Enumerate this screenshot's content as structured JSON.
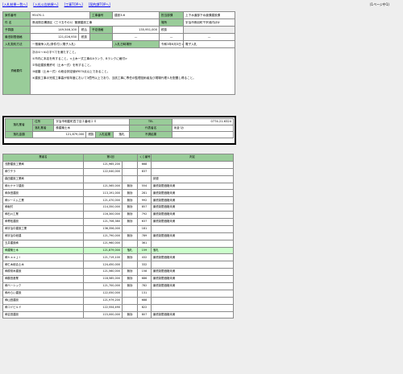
{
  "nav": {
    "links": [
      "[入札結果一覧へ]",
      "[入札公告結果へ]",
      "[工事TOPへ]",
      "[契約課TOPへ]"
    ],
    "page": "(1ページ中1)"
  },
  "info": {
    "row1": {
      "l1": "案件番号",
      "v1": "95470-1",
      "l2": "工事番号",
      "v2": "建設3-6",
      "l3": "担当部課",
      "v3": "上下水道部下水道課建設課"
    },
    "row2": {
      "l1": "件 名",
      "v1": "鳥羽周辺構造区（三十五その1）管渠建設工事",
      "l2": "場所",
      "v2": "宇治市鳥羽町千宗池内ほか"
    },
    "row3": {
      "l1": "予算額",
      "v1": "149,546,100",
      "t1": "税込",
      "l2": "予定価格",
      "v2": "135,951,000",
      "t2": "税抜"
    },
    "row4": {
      "l1": "最低制限価格",
      "v1": "121,026,930",
      "t1": "税抜",
      "v2": "—",
      "v3": "—",
      "v4": "—"
    },
    "row5": {
      "l1": "入札契約方法",
      "v1": "一般競争入札(条件付) (電子入札)",
      "l2": "入札日時場所",
      "v2": "令和3年6月3日 AM9時00分",
      "l3": "電子入札"
    },
    "row6": {
      "l1": "資格要件",
      "lines": [
        "次の①〜④のすべてを満たすこと。",
        "①市内に本店を有すること。<土木一式工事のAランク、Bランクに格付>",
        "②特定建設業許可（土木一式）を有すること。",
        "③経審（土木一式）の総合評定値が670点以上であること。",
        "④建設工事の完成工事高が前年度において3億円以上であり、当該工事に専任の監理技術者及び現場代理人を配置し得ること。"
      ]
    }
  },
  "winner": {
    "l_addr": "住所",
    "addr": "宇治市明星町四丁目２番地１４",
    "l_tel": "TEL",
    "tel": "0774-21-6324",
    "l_name": "落札業者",
    "name": "株建築士木",
    "l_rep": "代表者名",
    "rep": "米倉 功",
    "l_amount": "落札金額",
    "amount": "121,879,000",
    "tax": "税抜",
    "l_result": "入札結果",
    "result": "落札",
    "l_failed": "不調結果"
  },
  "results": {
    "headers": [
      "業者名",
      "第1回",
      "くじ番号",
      "判定"
    ],
    "rows": [
      {
        "name": "浅野建設工業㈱",
        "bid": "121,965,200",
        "flag": "",
        "lot": "668",
        "judge": ""
      },
      {
        "name": "㈱ウチラ",
        "bid": "122,040,000",
        "flag": "",
        "lot": "837",
        "judge": ""
      },
      {
        "name": "森田建設工業㈱",
        "bid": "",
        "flag": "",
        "lot": "",
        "judge": "辞退"
      },
      {
        "name": "㈱カナヤマ建設",
        "bid": "121,565,000",
        "flag": "無効",
        "lot": "554",
        "judge": "最低制限価格未満"
      },
      {
        "name": "㈱永田建設",
        "bid": "113,191,000",
        "flag": "無効",
        "lot": "281",
        "judge": "最低制限価格未満"
      },
      {
        "name": "㈱ジーエム工業",
        "bid": "121,470,000",
        "flag": "無効",
        "lot": "992",
        "judge": "最低制限価格未満"
      },
      {
        "name": "㈱坂村",
        "bid": "114,350,000",
        "flag": "無効",
        "lot": "857",
        "judge": "最低制限価格未満"
      },
      {
        "name": "㈱石川工業",
        "bid": "116,300,000",
        "flag": "無効",
        "lot": "792",
        "judge": "最低制限価格未満"
      },
      {
        "name": "㈱青松建設",
        "bid": "121,706,380",
        "flag": "無効",
        "lot": "637",
        "judge": "最低制限価格未満"
      },
      {
        "name": "㈱宇治中建設工業",
        "bid": "136,356,000",
        "flag": "",
        "lot": "181",
        "judge": ""
      },
      {
        "name": "㈱宇治中総建",
        "bid": "121,790,000",
        "flag": "無効",
        "lot": "789",
        "judge": "最低制限価格未満"
      },
      {
        "name": "五井建設㈱",
        "bid": "121,960,000",
        "flag": "",
        "lot": "361",
        "judge": ""
      },
      {
        "name": "㈱建築士木",
        "bid": "121,879,000",
        "flag": "落札",
        "lot": "159",
        "judge": "落札"
      },
      {
        "name": "㈱ｔａｏｊｉ",
        "bid": "121,719,100",
        "flag": "無効",
        "lot": "432",
        "judge": "最低制限価格未満"
      },
      {
        "name": "㈱仁木総合土木",
        "bid": "124,450,000",
        "flag": "",
        "lot": "332",
        "judge": ""
      },
      {
        "name": "㈱原常木建設",
        "bid": "121,560,000",
        "flag": "無効",
        "lot": "158",
        "judge": "最低制限価格未満"
      },
      {
        "name": "㈱藤田産業",
        "bid": "118,585,000",
        "flag": "無効",
        "lot": "686",
        "judge": "最低制限価格未満"
      },
      {
        "name": "㈱ベーシック",
        "bid": "121,700,000",
        "flag": "無効",
        "lot": "782",
        "judge": "最低制限価格未満"
      },
      {
        "name": "㈱みらい建設",
        "bid": "122,050,000",
        "flag": "",
        "lot": "131",
        "judge": ""
      },
      {
        "name": "㈱山田建設",
        "bid": "121,979,200",
        "flag": "",
        "lot": "688",
        "judge": ""
      },
      {
        "name": "㈱コイビルド",
        "bid": "122,554,490",
        "flag": "",
        "lot": "822",
        "judge": ""
      },
      {
        "name": "㈱吉田建設",
        "bid": "115,000,000",
        "flag": "無効",
        "lot": "807",
        "judge": "最低制限価格未満"
      }
    ]
  }
}
